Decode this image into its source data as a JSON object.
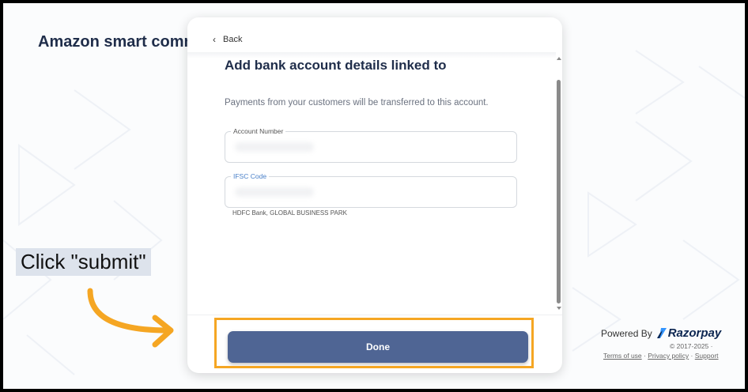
{
  "merchant": {
    "title": "Amazon smart comm"
  },
  "modal": {
    "back_label": "Back",
    "heading": "Add bank account details linked to",
    "subtext": "Payments from your customers will be transferred to this account.",
    "account_number": {
      "label": "Account Number",
      "value": ""
    },
    "ifsc": {
      "label": "IFSC Code",
      "value": ""
    },
    "bank_name": "HDFC Bank, GLOBAL BUSINESS PARK",
    "done_label": "Done"
  },
  "annotation": {
    "instruction": "Click \"submit\"",
    "highlight_color": "#f5a623"
  },
  "footer": {
    "powered_by": "Powered By",
    "brand": "Razorpay",
    "copyright": "© 2017-2025 ·",
    "links": [
      "Terms of use",
      "Privacy policy",
      "Support"
    ],
    "separator": " · "
  },
  "colors": {
    "heading": "#1f2d4a",
    "button": "#4f6594",
    "focus_label": "#4a80c9"
  },
  "icons": {
    "back": "chevron-left-icon",
    "brand": "razorpay-logo-icon",
    "pointer": "curved-arrow-icon"
  }
}
